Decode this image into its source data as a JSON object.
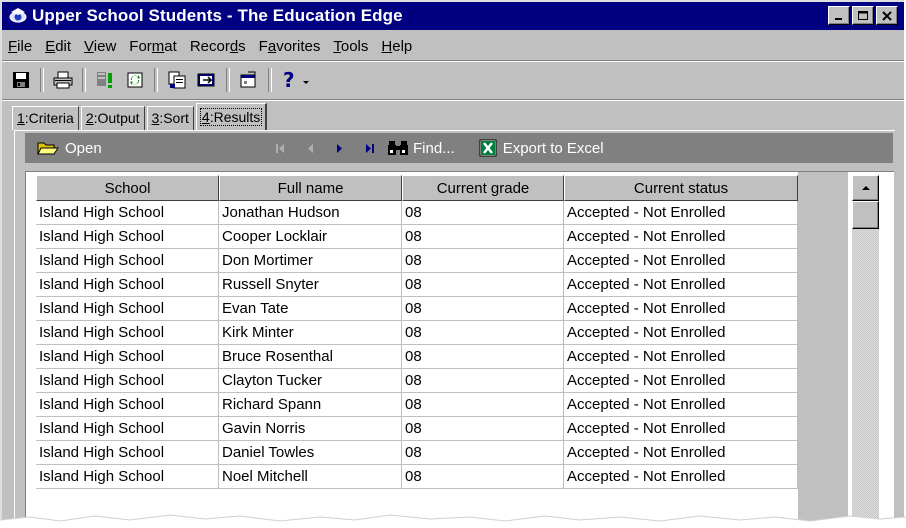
{
  "window": {
    "title": "Upper School Students - The Education Edge",
    "controls": {
      "minimize": "_",
      "maximize": "□",
      "close": "×"
    }
  },
  "menu": {
    "items": [
      {
        "pre": "",
        "key": "F",
        "post": "ile"
      },
      {
        "pre": "",
        "key": "E",
        "post": "dit"
      },
      {
        "pre": "",
        "key": "V",
        "post": "iew"
      },
      {
        "pre": "For",
        "key": "m",
        "post": "at"
      },
      {
        "pre": "Recor",
        "key": "d",
        "post": "s"
      },
      {
        "pre": "F",
        "key": "a",
        "post": "vorites"
      },
      {
        "pre": "",
        "key": "T",
        "post": "ools"
      },
      {
        "pre": "",
        "key": "H",
        "post": "elp"
      }
    ]
  },
  "toolbar": {
    "icons": [
      "save-icon",
      "print-icon",
      "alert-icon",
      "refresh-icon",
      "copy-icon",
      "export-icon",
      "properties-icon",
      "help-icon"
    ]
  },
  "tabs": [
    {
      "key": "1",
      "label": ":Criteria",
      "active": false
    },
    {
      "key": "2",
      "label": ":Output",
      "active": false
    },
    {
      "key": "3",
      "label": ":Sort",
      "active": false
    },
    {
      "key": "4",
      "label": ":Results",
      "active": true
    }
  ],
  "action_bar": {
    "open_label": "Open",
    "find_label": "Find...",
    "export_label": "Export to Excel"
  },
  "grid": {
    "columns": [
      "School",
      "Full name",
      "Current grade",
      "Current status"
    ],
    "rows": [
      [
        "Island High School",
        "Jonathan Hudson",
        "08",
        "Accepted - Not Enrolled"
      ],
      [
        "Island High School",
        "Cooper Locklair",
        "08",
        "Accepted - Not Enrolled"
      ],
      [
        "Island High School",
        "Don Mortimer",
        "08",
        "Accepted - Not Enrolled"
      ],
      [
        "Island High School",
        "Russell Snyter",
        "08",
        "Accepted - Not Enrolled"
      ],
      [
        "Island High School",
        "Evan Tate",
        "08",
        "Accepted - Not Enrolled"
      ],
      [
        "Island High School",
        "Kirk Minter",
        "08",
        "Accepted - Not Enrolled"
      ],
      [
        "Island High School",
        "Bruce Rosenthal",
        "08",
        "Accepted - Not Enrolled"
      ],
      [
        "Island High School",
        "Clayton Tucker",
        "08",
        "Accepted - Not Enrolled"
      ],
      [
        "Island High School",
        "Richard Spann",
        "08",
        "Accepted - Not Enrolled"
      ],
      [
        "Island High School",
        "Gavin Norris",
        "08",
        "Accepted - Not Enrolled"
      ],
      [
        "Island High School",
        "Daniel Towles",
        "08",
        "Accepted - Not Enrolled"
      ],
      [
        "Island High School",
        "Noel Mitchell",
        "08",
        "Accepted - Not Enrolled"
      ]
    ]
  },
  "colors": {
    "titlebar": "#000080",
    "chrome": "#c0c0c0",
    "action_bar": "#808080"
  }
}
